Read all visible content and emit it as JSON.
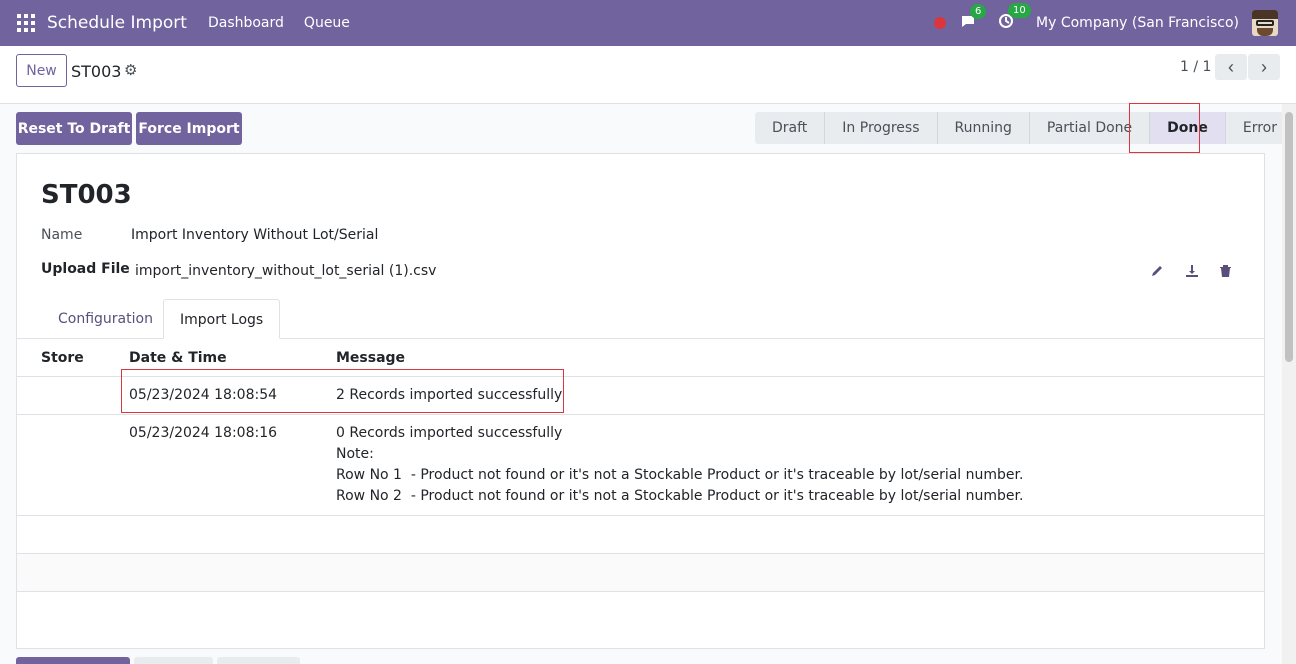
{
  "navbar": {
    "app_title": "Schedule Import",
    "menus": [
      "Dashboard",
      "Queue"
    ],
    "messages_count": "6",
    "activities_count": "10",
    "company": "My Company (San Francisco)"
  },
  "control": {
    "new_label": "New",
    "breadcrumb": "ST003",
    "pager": "1 / 1"
  },
  "actions": {
    "reset_label": "Reset To Draft",
    "force_label": "Force Import"
  },
  "statusbar": {
    "stages": [
      "Draft",
      "In Progress",
      "Running",
      "Partial Done",
      "Done",
      "Error"
    ],
    "active": "Done"
  },
  "record": {
    "title": "ST003",
    "name_label": "Name",
    "name_value": "Import Inventory Without Lot/Serial",
    "upload_label": "Upload File",
    "upload_value": "import_inventory_without_lot_serial (1).csv"
  },
  "tabs": [
    "Configuration",
    "Import Logs"
  ],
  "logs": {
    "headers": [
      "Store",
      "Date & Time",
      "Message"
    ],
    "rows": [
      {
        "store": "",
        "datetime": "05/23/2024 18:08:54",
        "message": [
          "2 Records imported successfully"
        ]
      },
      {
        "store": "",
        "datetime": "05/23/2024 18:08:16",
        "message": [
          "0 Records imported successfully",
          "Note:",
          "Row No 1  - Product not found or it's not a Stockable Product or it's traceable by lot/serial number.",
          "Row No 2  - Product not found or it's not a Stockable Product or it's traceable by lot/serial number."
        ]
      }
    ]
  },
  "colors": {
    "brand": "#71639e",
    "highlight": "#d9363e"
  }
}
